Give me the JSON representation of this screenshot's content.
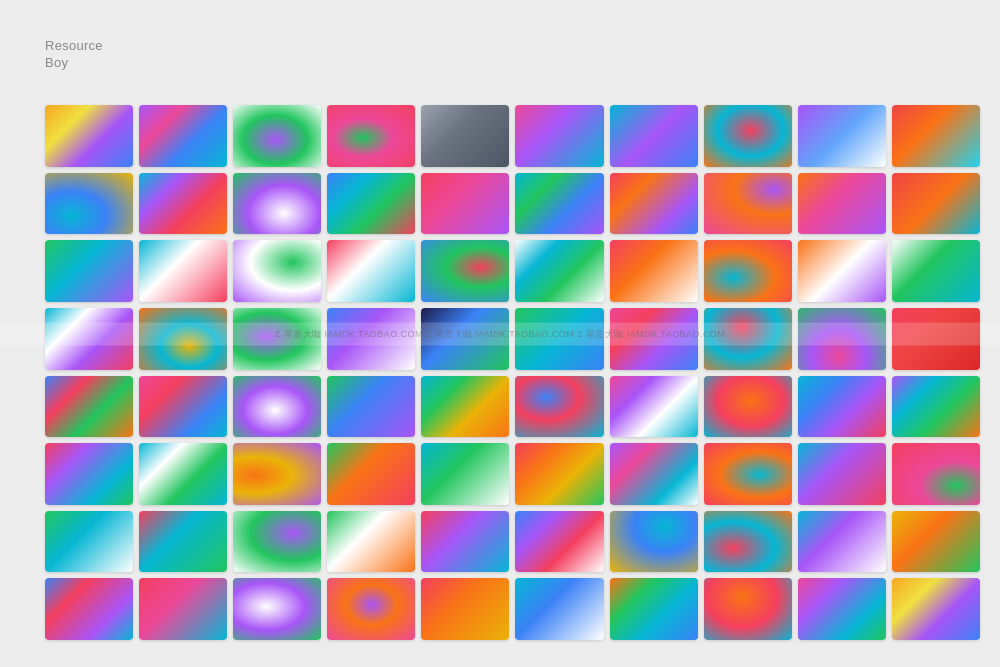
{
  "logo": {
    "line1": "Resource",
    "line2": "Boy"
  },
  "watermark": "Z 星道大咖  IAMDK.TAOBAO.COM   Z 星道大咖  IAMDK.TAOBAO.COM   Z 星道大咖  IAMDK.TAOBAO.COM",
  "gradients": [
    "linear-gradient(135deg, #f5a623 0%, #f0e040 30%, #a855f7 60%, #3b82f6 100%)",
    "linear-gradient(135deg, #a855f7 0%, #ec4899 30%, #3b82f6 60%, #06b6d4 100%)",
    "linear-gradient(135deg, #ec4899 0%, #a855f7 30%, #7c3aed 60%, #06b6d4 100%)",
    "linear-gradient(135deg, #06b6d4 0%, #3b82f6 30%, #a855f7 60%, #ec4899 100%)",
    "linear-gradient(135deg, #9ca3af 0%, #6b7280 40%, #4b5563 100%)",
    "linear-gradient(135deg, #ec4899 0%, #a855f7 40%, #06b6d4 100%)",
    "linear-gradient(135deg, #06b6d4 0%, #a855f7 50%, #3b82f6 100%)",
    "linear-gradient(135deg, #f43f5e 0%, #ec4899 30%, #a855f7 60%, #3b82f6 100%)",
    "linear-gradient(135deg, #a855f7 0%, #60a5fa 50%, #ffffff 100%)",
    "linear-gradient(135deg, #ef4444 0%, #f97316 40%, #22d3ee 100%)",
    "linear-gradient(135deg, #22c55e 0%, #06b6d4 40%, #3b82f6 100%)",
    "linear-gradient(135deg, #06b6d4 0%, #a855f7 30%, #f43f5e 60%, #f97316 100%)",
    "linear-gradient(135deg, #f43f5e 0%, #a855f7 50%, #06b6d4 100%)",
    "linear-gradient(135deg, #3b82f6 0%, #06b6d4 30%, #22c55e 60%, #f43f5e 100%)",
    "linear-gradient(135deg, #f43f5e 0%, #ec4899 40%, #a855f7 100%)",
    "linear-gradient(135deg, #06b6d4 0%, #22c55e 30%, #3b82f6 60%, #a855f7 100%)",
    "linear-gradient(135deg, #f43f5e 0%, #f97316 30%, #a855f7 70%, #3b82f6 100%)",
    "linear-gradient(135deg, #a855f7 0%, #ec4899 30%, #f43f5e 60%, #ffffff 100%)",
    "linear-gradient(135deg, #f97316 0%, #ec4899 40%, #a855f7 100%)",
    "linear-gradient(135deg, #ef4444 0%, #f97316 50%, #06b6d4 100%)",
    "linear-gradient(135deg, #22c55e 0%, #06b6d4 40%, #a855f7 100%)",
    "linear-gradient(135deg, #06b6d4 0%, #ffffff 40%, #f43f5e 100%)",
    "linear-gradient(135deg, #ffffff 0%, #06b6d4 40%, #a855f7 100%)",
    "linear-gradient(135deg, #f43f5e 0%, #ffffff 40%, #06b6d4 100%)",
    "linear-gradient(135deg, #f97316 0%, #ffffff 40%, #a855f7 100%)",
    "linear-gradient(135deg, #ffffff 0%, #06b6d4 30%, #22c55e 60%, #ffffff 100%)",
    "linear-gradient(135deg, #f43f5e 0%, #f97316 40%, #ffffff 100%)",
    "linear-gradient(135deg, #a855f7 0%, #ffffff 40%, #f43f5e 100%)",
    "linear-gradient(135deg, #f97316 0%, #ffffff 50%, #a855f7 100%)",
    "linear-gradient(135deg, #ffffff 0%, #22c55e 40%, #06b6d4 100%)",
    "linear-gradient(135deg, #06b6d4 0%, #ffffff 30%, #a855f7 60%, #f43f5e 100%)",
    "linear-gradient(135deg, #22c55e 0%, #ffffff 40%, #06b6d4 100%)",
    "linear-gradient(135deg, #ffffff 0%, #a855f7 40%, #06b6d4 100%)",
    "linear-gradient(135deg, #3b82f6 0%, #a855f7 40%, #ffffff 100%)",
    "linear-gradient(135deg, #1e1b4b 0%, #3b82f6 40%, #22c55e 100%)",
    "linear-gradient(135deg, #22c55e 0%, #06b6d4 50%, #3b82f6 100%)",
    "linear-gradient(135deg, #ec4899 0%, #f43f5e 30%, #a855f7 60%, #3b82f6 100%)",
    "linear-gradient(135deg, #f97316 0%, #ffffff 40%, #a855f7 100%)",
    "linear-gradient(135deg, #ef4444 0%, #f43f5e 40%, #ffffff 100%)",
    "linear-gradient(135deg, #f43f5e 0%, #ef4444 40%, #dc2626 100%)",
    "linear-gradient(135deg, #3b82f6 0%, #f43f5e 30%, #22c55e 60%, #f97316 100%)",
    "linear-gradient(135deg, #ec4899 0%, #f43f5e 30%, #3b82f6 70%, #06b6d4 100%)",
    "linear-gradient(135deg, #f97316 0%, #ef4444 40%, #22c55e 100%)",
    "linear-gradient(135deg, #22c55e 0%, #3b82f6 40%, #a855f7 100%)",
    "linear-gradient(135deg, #06b6d4 0%, #22c55e 30%, #eab308 60%, #f97316 100%)",
    "linear-gradient(135deg, #22c55e 0%, #06b6d4 50%, #a855f7 100%)",
    "linear-gradient(135deg, #ec4899 0%, #a855f7 30%, #ffffff 60%, #06b6d4 100%)",
    "linear-gradient(135deg, #eab308 0%, #f97316 40%, #ef4444 100%)",
    "linear-gradient(135deg, #06b6d4 0%, #3b82f6 30%, #a855f7 60%, #f43f5e 100%)",
    "linear-gradient(135deg, #a855f7 0%, #06b6d4 30%, #22c55e 60%, #f97316 100%)",
    "linear-gradient(135deg, #f43f5e 0%, #a855f7 30%, #06b6d4 70%, #22c55e 100%)",
    "linear-gradient(135deg, #06b6d4 0%, #ffffff 30%, #22c55e 60%, #06b6d4 100%)",
    "linear-gradient(135deg, #3b82f6 0%, #a855f7 40%, #f43f5e 100%)",
    "linear-gradient(135deg, #22c55e 0%, #f97316 40%, #f43f5e 100%)",
    "linear-gradient(135deg, #06b6d4 0%, #22c55e 40%, #ffffff 100%)",
    "linear-gradient(135deg, #f43f5e 0%, #f97316 30%, #eab308 60%, #22c55e 100%)",
    "linear-gradient(135deg, #a855f7 0%, #ec4899 30%, #06b6d4 70%, #ffffff 100%)",
    "linear-gradient(135deg, #f97316 0%, #f43f5e 40%, #ffffff 100%)",
    "linear-gradient(135deg, #06b6d4 0%, #a855f7 40%, #f43f5e 100%)",
    "linear-gradient(135deg, #a855f7 0%, #f43f5e 30%, #f97316 60%, #eab308 100%)",
    "linear-gradient(135deg, #22c55e 0%, #06b6d4 40%, #ffffff 100%)",
    "linear-gradient(135deg, #f43f5e 0%, #06b6d4 40%, #22c55e 100%)",
    "linear-gradient(135deg, #06b6d4 0%, #ffffff 40%, #a855f7 100%)",
    "linear-gradient(135deg, #22c55e 0%, #ffffff 40%, #f97316 100%)",
    "linear-gradient(135deg, #f43f5e 0%, #a855f7 40%, #06b6d4 100%)",
    "linear-gradient(135deg, #3b82f6 0%, #a855f7 30%, #f43f5e 60%, #ffffff 100%)",
    "linear-gradient(135deg, #f43f5e 0%, #f97316 30%, #ffffff 60%, #06b6d4 100%)",
    "linear-gradient(135deg, #a855f7 0%, #3b82f6 30%, #06b6d4 60%, #22c55e 100%)",
    "linear-gradient(135deg, #06b6d4 0%, #a855f7 40%, #ffffff 100%)",
    "linear-gradient(135deg, #eab308 0%, #f97316 40%, #22c55e 100%)",
    "linear-gradient(135deg, #3b82f6 0%, #f43f5e 30%, #a855f7 70%, #06b6d4 100%)",
    "linear-gradient(135deg, #f43f5e 0%, #ec4899 40%, #06b6d4 100%)",
    "linear-gradient(135deg, #22c55e 0%, #06b6d4 30%, #ffffff 60%, #f43f5e 100%)",
    "linear-gradient(135deg, #a855f7 0%, #ec4899 40%, #f43f5e 100%)",
    "linear-gradient(135deg, #f43f5e 0%, #f97316 40%, #eab308 100%)",
    "linear-gradient(135deg, #06b6d4 0%, #3b82f6 40%, #ffffff 100%)",
    "linear-gradient(135deg, #f97316 0%, #22c55e 30%, #06b6d4 60%, #3b82f6 100%)",
    "linear-gradient(135deg, #a855f7 0%, #f43f5e 30%, #06b6d4 70%, #22c55e 100%)",
    "linear-gradient(135deg, #ec4899 0%, #a855f7 30%, #06b6d4 70%, #22c55e 100%)"
  ]
}
